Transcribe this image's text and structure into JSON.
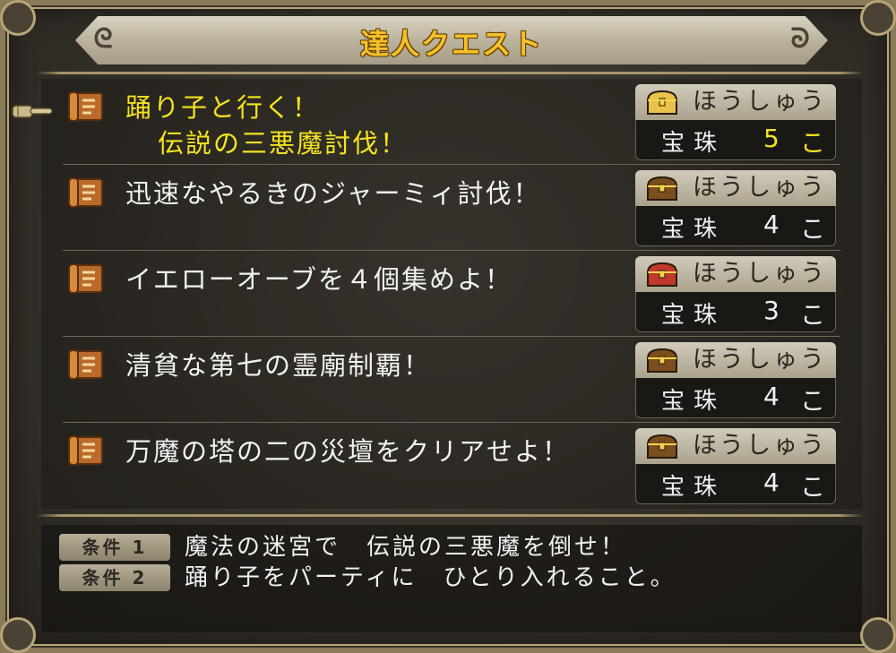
{
  "header": {
    "title": "達人クエスト"
  },
  "quests": [
    {
      "title_line1": "踊り子と行く！",
      "title_line2": "伝説の三悪魔討伐！",
      "selected": true,
      "reward_label": "ほうしゅう",
      "gem_label": "宝珠",
      "gem_count": "5",
      "unit": "こ",
      "chest": "gold"
    },
    {
      "title_line1": "迅速なやるきのジャーミィ討伐！",
      "title_line2": "",
      "selected": false,
      "reward_label": "ほうしゅう",
      "gem_label": "宝珠",
      "gem_count": "4",
      "unit": "こ",
      "chest": "brown"
    },
    {
      "title_line1": "イエローオーブを４個集めよ！",
      "title_line2": "",
      "selected": false,
      "reward_label": "ほうしゅう",
      "gem_label": "宝珠",
      "gem_count": "3",
      "unit": "こ",
      "chest": "red"
    },
    {
      "title_line1": "清貧な第七の霊廟制覇！",
      "title_line2": "",
      "selected": false,
      "reward_label": "ほうしゅう",
      "gem_label": "宝珠",
      "gem_count": "4",
      "unit": "こ",
      "chest": "brown"
    },
    {
      "title_line1": "万魔の塔の二の災壇をクリアせよ！",
      "title_line2": "",
      "selected": false,
      "reward_label": "ほうしゅう",
      "gem_label": "宝珠",
      "gem_count": "4",
      "unit": "こ",
      "chest": "brown"
    }
  ],
  "conditions": [
    {
      "tag": "条件 1",
      "text": "魔法の迷宮で　伝説の三悪魔を倒せ！"
    },
    {
      "tag": "条件 2",
      "text": "踊り子をパーティに　ひとり入れること。"
    }
  ],
  "colors": {
    "highlight": "#f3e31f",
    "title": "#f5c02a",
    "chest_gold": "#e8c24a",
    "chest_brown": "#7a4e1e",
    "chest_red": "#c0392b"
  },
  "icons": {
    "quest": "quest-scroll-icon",
    "reward": "treasure-chest-icon",
    "cursor": "pointing-hand-cursor-icon"
  }
}
